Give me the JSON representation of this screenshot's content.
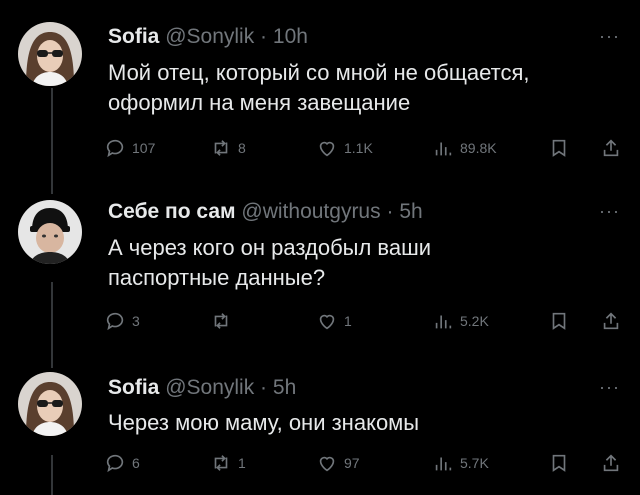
{
  "tweets": [
    {
      "name": "Sofia",
      "handle": "@Sonylik",
      "sep": "·",
      "time": "10h",
      "text": "Мой отец, который со мной не общается, оформил на меня завещание",
      "replies": "107",
      "reposts": "8",
      "likes": "1.1K",
      "views": "89.8K"
    },
    {
      "name": "Себе по сам",
      "handle": "@withoutgyrus",
      "sep": "·",
      "time": "5h",
      "text": "А через кого он раздобыл ваши паспортные данные?",
      "replies": "3",
      "reposts": "",
      "likes": "1",
      "views": "5.2K"
    },
    {
      "name": "Sofia",
      "handle": "@Sonylik",
      "sep": "·",
      "time": "5h",
      "text": "Через мою маму, они знакомы",
      "replies": "6",
      "reposts": "1",
      "likes": "97",
      "views": "5.7K"
    }
  ],
  "more_label": "···",
  "colors": {
    "background": "#000000",
    "text": "#e7e9ea",
    "muted": "#71767b",
    "thread": "#333639"
  }
}
